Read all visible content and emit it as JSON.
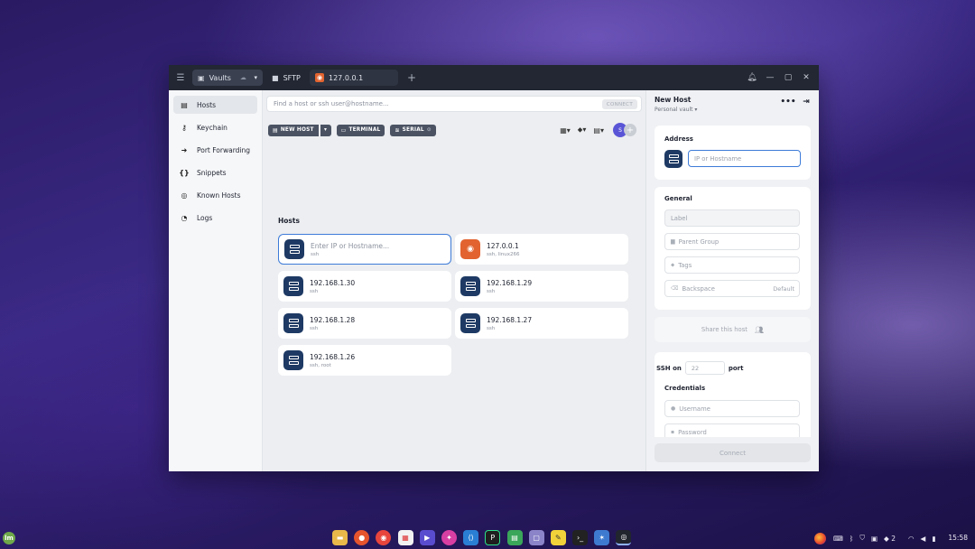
{
  "titlebar": {
    "tabs": [
      {
        "label": "Vaults",
        "icon": "vault-icon"
      },
      {
        "label": "SFTP",
        "icon": "folder-icon"
      },
      {
        "label": "127.0.0.1",
        "icon": "ubuntu-icon"
      }
    ],
    "add_tab": "+",
    "window_controls": [
      "bell-icon",
      "minimize-icon",
      "maximize-icon",
      "close-icon"
    ]
  },
  "sidebar": {
    "items": [
      {
        "label": "Hosts",
        "icon": "hosts-icon",
        "active": true
      },
      {
        "label": "Keychain",
        "icon": "key-icon"
      },
      {
        "label": "Port Forwarding",
        "icon": "forward-icon"
      },
      {
        "label": "Snippets",
        "icon": "snippets-icon"
      },
      {
        "label": "Known Hosts",
        "icon": "fingerprint-icon"
      },
      {
        "label": "Logs",
        "icon": "logs-icon"
      }
    ]
  },
  "main": {
    "search_placeholder": "Find a host or ssh user@hostname...",
    "connect_label": "CONNECT",
    "toolbar": {
      "new_host": "NEW HOST",
      "terminal": "TERMINAL",
      "serial": "SERIAL"
    },
    "avatar_initial": "S",
    "section_title": "Hosts",
    "hosts": [
      {
        "title": "Enter IP or Hostname...",
        "subtitle": "ssh",
        "kind": "input"
      },
      {
        "title": "127.0.0.1",
        "subtitle": "ssh, linux266",
        "kind": "ubuntu"
      },
      {
        "title": "192.168.1.30",
        "subtitle": "ssh",
        "kind": "server"
      },
      {
        "title": "192.168.1.29",
        "subtitle": "ssh",
        "kind": "server"
      },
      {
        "title": "192.168.1.28",
        "subtitle": "ssh",
        "kind": "server"
      },
      {
        "title": "192.168.1.27",
        "subtitle": "ssh",
        "kind": "server"
      },
      {
        "title": "192.168.1.26",
        "subtitle": "ssh, root",
        "kind": "server"
      }
    ]
  },
  "panel": {
    "title": "New Host",
    "subtitle": "Personal vault",
    "address_label": "Address",
    "address_placeholder": "IP or Hostname",
    "general_label": "General",
    "label_placeholder": "Label",
    "parent_group_placeholder": "Parent Group",
    "tags_placeholder": "Tags",
    "backspace_placeholder": "Backspace",
    "backspace_value": "Default",
    "share_label": "Share this host",
    "ssh_on": "SSH on",
    "port_value": "22",
    "port_label": "port",
    "credentials_label": "Credentials",
    "username_placeholder": "Username",
    "password_placeholder": "Password",
    "connect_label": "Connect"
  },
  "taskbar": {
    "start_label": "lm",
    "apps": [
      {
        "name": "files",
        "color": "#e8b84a"
      },
      {
        "name": "firefox",
        "color": "#e5542d"
      },
      {
        "name": "chrome",
        "color": "#e8453c"
      },
      {
        "name": "calendar",
        "color": "#f2f2f2"
      },
      {
        "name": "media-player",
        "color": "#5a4ccf"
      },
      {
        "name": "design-app",
        "color": "#d83fa2"
      },
      {
        "name": "vscode",
        "color": "#2a7fd4"
      },
      {
        "name": "pycharm",
        "color": "#1f1f1f"
      },
      {
        "name": "spreadsheet",
        "color": "#3aa65a"
      },
      {
        "name": "app-purple",
        "color": "#8b84c9"
      },
      {
        "name": "notes",
        "color": "#f2d23a"
      },
      {
        "name": "terminal",
        "color": "#222222"
      },
      {
        "name": "network-tool",
        "color": "#3e7bd0"
      },
      {
        "name": "termius",
        "color": "#21252e"
      }
    ],
    "tray_count": "2",
    "clock": "15:58"
  }
}
